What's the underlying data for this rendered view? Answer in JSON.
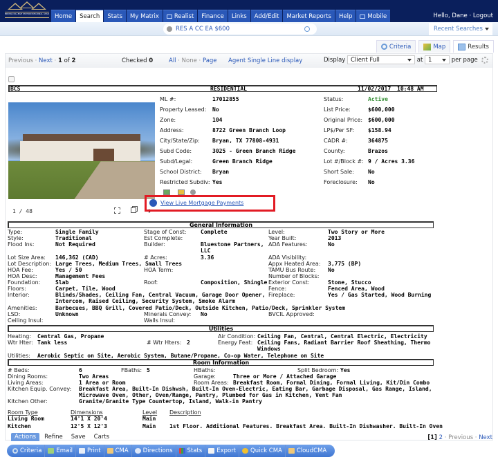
{
  "header": {
    "logo_text": "BRYAN-COLLEGE STATION REGIONAL ASSOCIATION of REALTORS",
    "nav": [
      {
        "label": "Home",
        "active": false
      },
      {
        "label": "Search",
        "active": true
      },
      {
        "label": "Stats",
        "active": false
      },
      {
        "label": "My Matrix",
        "active": false
      },
      {
        "label": "Realist",
        "active": false,
        "icon": "window-icon"
      },
      {
        "label": "Finance",
        "active": false
      },
      {
        "label": "Links",
        "active": false
      },
      {
        "label": "Add/Edit",
        "active": false
      },
      {
        "label": "Market Reports",
        "active": false
      },
      {
        "label": "Help",
        "active": false
      },
      {
        "label": "Mobile",
        "active": false,
        "icon": "window-icon"
      }
    ],
    "greeting": "Hello, Dane",
    "logout": "Logout"
  },
  "subbar": {
    "quick_search_value": "RES A CC EA $600",
    "recent_searches": "Recent Searches"
  },
  "view_tabs": [
    {
      "label": "Criteria",
      "icon": "magnifier-icon",
      "active": false
    },
    {
      "label": "Map",
      "icon": "map-icon",
      "active": false
    },
    {
      "label": "Results",
      "icon": "grid-icon",
      "active": true
    }
  ],
  "pager": {
    "previous": "Previous",
    "next": "Next",
    "current": "1",
    "of_label": "of",
    "total": "2",
    "checked_label": "Checked",
    "checked_count": "0",
    "all": "All",
    "none": "None",
    "page": "Page",
    "agent_single_line": "Agent Single Line display",
    "display_label": "Display",
    "display_value": "Client Full",
    "at_label": "at",
    "per_page_value": "1",
    "per_page_label": "per page"
  },
  "listing": {
    "board": "BCS",
    "type": "RESIDENTIAL",
    "date": "11/02/2017",
    "time": "10:48 AM",
    "photo_counter": "1 / 48",
    "left_fields": [
      {
        "label": "ML #:",
        "value": "17012855"
      },
      {
        "label": "Property Leased:",
        "value": "No"
      },
      {
        "label": "Zone:",
        "value": "104"
      },
      {
        "label": "Address:",
        "value": "8722 Green Branch Loop"
      },
      {
        "label": "City/State/Zip:",
        "value": "Bryan, TX 77808-4931"
      },
      {
        "label": "Subd Code:",
        "value": "3025 - Green Branch Ridge"
      },
      {
        "label": "Subd/Legal:",
        "value": "Green Branch Ridge"
      },
      {
        "label": "School District:",
        "value": "Bryan"
      },
      {
        "label": "Restricted Subdiv:",
        "value": "Yes"
      }
    ],
    "right_fields": [
      {
        "label": "Status:",
        "value": "Active",
        "color": "#2e8b2e"
      },
      {
        "label": "List Price:",
        "value": "$600,000"
      },
      {
        "label": "Original Price:",
        "value": "$600,000"
      },
      {
        "label": "LP$/Per SF:",
        "value": "$158.94"
      },
      {
        "label": "CADR #:",
        "value": "364875"
      },
      {
        "label": "County:",
        "value": "Brazos"
      },
      {
        "label": "Lot #/Block #:",
        "value": "9 / Acres 3.36"
      },
      {
        "label": "Short Sale:",
        "value": "No"
      },
      {
        "label": "Foreclosure:",
        "value": "No"
      }
    ],
    "mortgage_link": "View Live Mortgage Payments",
    "highlight_color": "#e21b24"
  },
  "general": {
    "title": "General Information",
    "type_l": "Type:",
    "type_v": "Single Family",
    "stage_l": "Stage of Const:",
    "stage_v": "Complete",
    "level_l": "Level:",
    "level_v": "Two Story or More",
    "style_l": "Style:",
    "style_v": "Traditional",
    "estc_l": "Est Complete:",
    "year_l": "Year Built:",
    "year_v": "2013",
    "flood_l": "Flood Ins:",
    "flood_v": "Not Required",
    "builder_l": "Builder:",
    "builder_v": "Bluestone Partners,",
    "builder_v2": "LLC",
    "ada_l": "ADA Features:",
    "ada_v": "No",
    "lotsize_l": "Lot Size Area:",
    "lotsize_v": "146,362 (CAD)",
    "acres_l": "# Acres:",
    "acres_v": "3.36",
    "adavis_l": "ADA Visibility:",
    "lotdesc_l": "Lot Description:",
    "lotdesc_v": "Large Trees, Medium Trees, Small Trees",
    "heated_l": "Appx Heated Area:",
    "heated_v": "3,775 (BP)",
    "hoafee_l": "HOA Fee:",
    "hoafee_v": "Yes / 50",
    "hoaterm_l": "HOA Term:",
    "tamu_l": "TAMU Bus Route:",
    "tamu_v": "No",
    "hoadesc_l": "HOA Desc:",
    "hoadesc_v": "Management Fees",
    "blocks_l": "Number of Blocks:",
    "found_l": "Foundation:",
    "found_v": "Slab",
    "roof_l": "Roof:",
    "roof_v": "Composition, Shingle",
    "ext_l": "Exterior Const:",
    "ext_v": "Stone, Stucco",
    "floors_l": "Floors:",
    "floors_v": "Carpet, Tile, Wood",
    "fence_l": "Fence:",
    "fence_v": "Fenced Area, Wood",
    "interior_l": "Interior:",
    "interior_v": "Blinds/Shades, Ceiling Fan, Central Vacuum, Garage Door Opener,",
    "interior_v2": "Intercom, Raised Ceiling, Security System, Smoke Alarm",
    "fire_l": "Fireplace:",
    "fire_v": "Yes / Gas Started, Wood Burning",
    "amen_l": "Amenities:",
    "amen_v": "Barbecues, BBQ Grill, Covered Patio/Deck, Outside Kitchen, Patio/Deck, Sprinkler System",
    "lsd_l": "LSD:",
    "lsd_v": "Unknown",
    "min_l": "Minerals Convey:",
    "min_v": "No",
    "bvcil_l": "BVCIL Approved:",
    "ceil_l": "Ceiling Insul:",
    "walls_l": "Walls Insul:"
  },
  "utilities": {
    "title": "Utilities",
    "heat_l": "Heating:",
    "heat_v": "Central Gas, Propane",
    "ac_l": "Air Condition:",
    "ac_v": "Ceiling Fan, Central, Central Electric, Electricity",
    "wh_l": "Wtr Hter:",
    "wh_v": "Tank less",
    "nwh_l": "# Wtr Hters:",
    "nwh_v": "2",
    "energy_l": "Energy Feat:",
    "energy_v": "Ceiling Fans, Radiant Barrier Roof Sheathing, Thermo",
    "energy_v2": "Windows",
    "util_l": "Utilities:",
    "util_v": "Aerobic Septic on Site, Aerobic System, Butane/Propane, Co-op Water, Telephone on Site"
  },
  "rooms": {
    "title": "Room Information",
    "beds_l": "# Beds:",
    "beds_v": "6",
    "fb_l": "FBaths:",
    "fb_v": "5",
    "hb_l": "HBaths:",
    "split_l": "Split Bedroom:",
    "split_v": "Yes",
    "dining_l": "Dining Rooms:",
    "dining_v": "Two Areas",
    "garage_l": "Garage:",
    "garage_v": "Three or More / Attached Garage",
    "living_l": "Living Areas:",
    "living_v": "1 Area or Room",
    "roomareas_l": "Room Areas:",
    "roomareas_v": "Breakfast Room, Formal Dining, Formal Living, Kit/Din Combo",
    "kitchen_l": "Kitchen Equip. Convey:",
    "kitchen_v": "Breakfast Area, Built-In Dishwsh, Built-In Oven-Electric, Eating Bar, Garbage Disposal, Gas Range, Island,",
    "kitchen_v2": "Microwave Oven, Other, Oven/Range, Pantry, Plumbed for Gas in Kitchen, Vent Fan",
    "kother_l": "Kitchen Other:",
    "kother_v": "Granite/Granite Type Countertop, Island, Walk-in Pantry",
    "table_headers": [
      "Room Type",
      "Dimensions",
      "Level",
      "Description"
    ],
    "table_rows": [
      [
        "Living Room",
        "14'1 X 20'4",
        "Main",
        ""
      ],
      [
        "Kitchen",
        "12'5 X 12'3",
        "Main",
        "1st Floor. Additional Features. Breakfast Area. Built-In Dishwasher. Built-In Oven"
      ]
    ]
  },
  "bottom": {
    "action_tabs": [
      "Actions",
      "Refine",
      "Save",
      "Carts"
    ],
    "toolbar": [
      {
        "label": "Criteria",
        "icon": "magnifier-icon"
      },
      {
        "label": "Email",
        "icon": "email-icon"
      },
      {
        "label": "Print",
        "icon": "printer-icon"
      },
      {
        "label": "CMA",
        "icon": "document-icon"
      },
      {
        "label": "Directions",
        "icon": "compass-icon"
      },
      {
        "label": "Stats",
        "icon": "bar-chart-icon"
      },
      {
        "label": "Export",
        "icon": "export-icon"
      },
      {
        "label": "Quick CMA",
        "icon": "coin-icon"
      },
      {
        "label": "CloudCMA",
        "icon": "document-icon"
      }
    ],
    "pager_current": "[1]",
    "pager_page2": "2",
    "previous": "Previous",
    "next": "Next"
  }
}
